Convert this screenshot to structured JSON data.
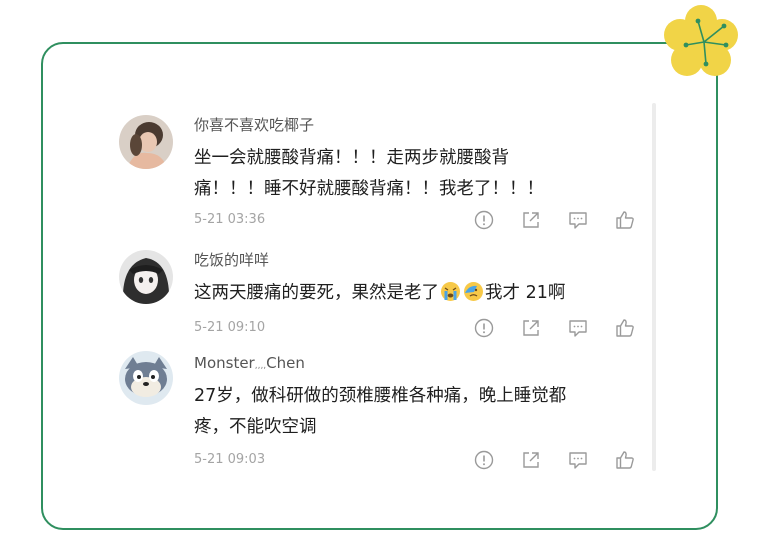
{
  "colors": {
    "frame": "#2f8f5f",
    "flower_petal": "#f1d447",
    "flower_stem": "#2f8f5f",
    "meta_text": "#a4a4a4",
    "icon": "#9a9a9a"
  },
  "comments": [
    {
      "username": "你喜不喜欢吃椰子",
      "text": "坐一会就腰酸背痛！！！走两步就腰酸背\n痛！！！睡不好就腰酸背痛！！我老了！！！",
      "date": "5-21 03:36",
      "avatar_icon": "user-photo-avatar"
    },
    {
      "username": "吃饭的咩咩",
      "text_before": "这两天腰痛的要死，果然是老了",
      "text_after": "我才 21啊",
      "emojis": [
        "crying-face-emoji",
        "sad-face-emoji"
      ],
      "date": "5-21 09:10",
      "avatar_icon": "anime-girl-avatar"
    },
    {
      "username": "Monster",
      "username_mid": ",,,,",
      "username_end": "Chen",
      "text": "27岁，做科研做的颈椎腰椎各种痛，晚上睡觉都\n疼，不能吹空调",
      "date": "5-21 09:03",
      "avatar_icon": "cartoon-cat-avatar"
    }
  ],
  "action_icons": [
    "report-icon",
    "share-icon",
    "reply-icon",
    "like-icon"
  ]
}
